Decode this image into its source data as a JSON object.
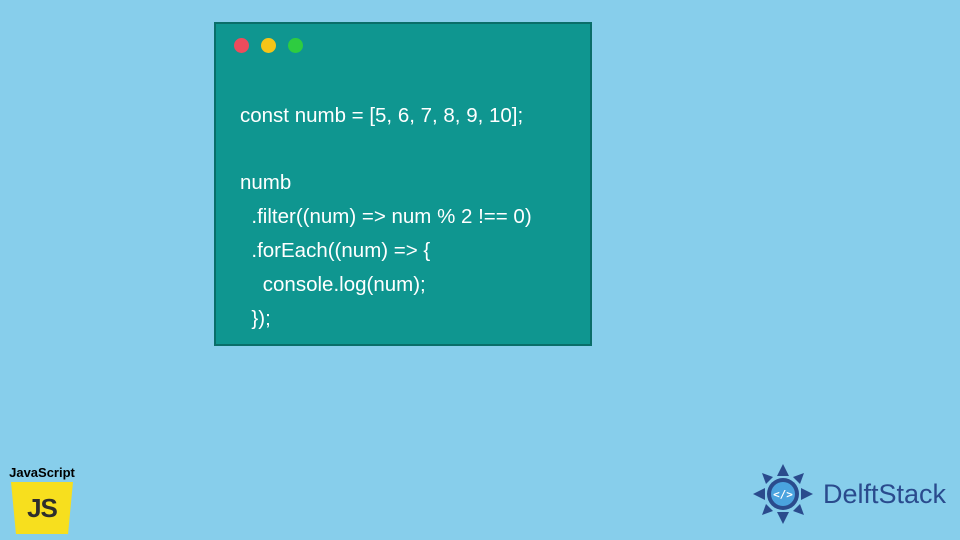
{
  "code_window": {
    "dots": [
      "red",
      "yellow",
      "green"
    ],
    "lines": [
      "const numb = [5, 6, 7, 8, 9, 10];",
      "",
      "numb",
      "  .filter((num) => num % 2 !== 0)",
      "  .forEach((num) => {",
      "    console.log(num);",
      "  });"
    ]
  },
  "js_badge": {
    "label": "JavaScript",
    "logo_text": "JS"
  },
  "brand": {
    "name": "DelftStack"
  },
  "colors": {
    "bg": "#87ceeb",
    "window": "#0f9690",
    "js_yellow": "#f7df1e",
    "brand_blue": "#2a4b8d"
  }
}
